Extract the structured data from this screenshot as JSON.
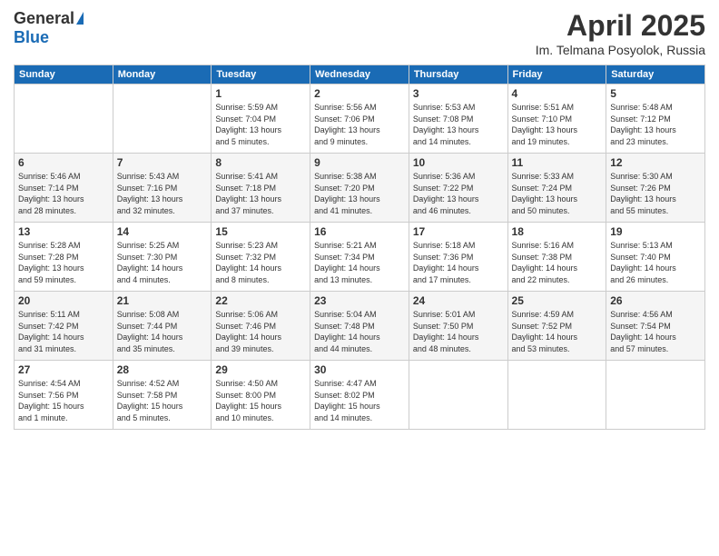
{
  "logo": {
    "general": "General",
    "blue": "Blue"
  },
  "header": {
    "title": "April 2025",
    "subtitle": "Im. Telmana Posyolok, Russia"
  },
  "days_of_week": [
    "Sunday",
    "Monday",
    "Tuesday",
    "Wednesday",
    "Thursday",
    "Friday",
    "Saturday"
  ],
  "weeks": [
    [
      {
        "day": "",
        "info": ""
      },
      {
        "day": "",
        "info": ""
      },
      {
        "day": "1",
        "info": "Sunrise: 5:59 AM\nSunset: 7:04 PM\nDaylight: 13 hours\nand 5 minutes."
      },
      {
        "day": "2",
        "info": "Sunrise: 5:56 AM\nSunset: 7:06 PM\nDaylight: 13 hours\nand 9 minutes."
      },
      {
        "day": "3",
        "info": "Sunrise: 5:53 AM\nSunset: 7:08 PM\nDaylight: 13 hours\nand 14 minutes."
      },
      {
        "day": "4",
        "info": "Sunrise: 5:51 AM\nSunset: 7:10 PM\nDaylight: 13 hours\nand 19 minutes."
      },
      {
        "day": "5",
        "info": "Sunrise: 5:48 AM\nSunset: 7:12 PM\nDaylight: 13 hours\nand 23 minutes."
      }
    ],
    [
      {
        "day": "6",
        "info": "Sunrise: 5:46 AM\nSunset: 7:14 PM\nDaylight: 13 hours\nand 28 minutes."
      },
      {
        "day": "7",
        "info": "Sunrise: 5:43 AM\nSunset: 7:16 PM\nDaylight: 13 hours\nand 32 minutes."
      },
      {
        "day": "8",
        "info": "Sunrise: 5:41 AM\nSunset: 7:18 PM\nDaylight: 13 hours\nand 37 minutes."
      },
      {
        "day": "9",
        "info": "Sunrise: 5:38 AM\nSunset: 7:20 PM\nDaylight: 13 hours\nand 41 minutes."
      },
      {
        "day": "10",
        "info": "Sunrise: 5:36 AM\nSunset: 7:22 PM\nDaylight: 13 hours\nand 46 minutes."
      },
      {
        "day": "11",
        "info": "Sunrise: 5:33 AM\nSunset: 7:24 PM\nDaylight: 13 hours\nand 50 minutes."
      },
      {
        "day": "12",
        "info": "Sunrise: 5:30 AM\nSunset: 7:26 PM\nDaylight: 13 hours\nand 55 minutes."
      }
    ],
    [
      {
        "day": "13",
        "info": "Sunrise: 5:28 AM\nSunset: 7:28 PM\nDaylight: 13 hours\nand 59 minutes."
      },
      {
        "day": "14",
        "info": "Sunrise: 5:25 AM\nSunset: 7:30 PM\nDaylight: 14 hours\nand 4 minutes."
      },
      {
        "day": "15",
        "info": "Sunrise: 5:23 AM\nSunset: 7:32 PM\nDaylight: 14 hours\nand 8 minutes."
      },
      {
        "day": "16",
        "info": "Sunrise: 5:21 AM\nSunset: 7:34 PM\nDaylight: 14 hours\nand 13 minutes."
      },
      {
        "day": "17",
        "info": "Sunrise: 5:18 AM\nSunset: 7:36 PM\nDaylight: 14 hours\nand 17 minutes."
      },
      {
        "day": "18",
        "info": "Sunrise: 5:16 AM\nSunset: 7:38 PM\nDaylight: 14 hours\nand 22 minutes."
      },
      {
        "day": "19",
        "info": "Sunrise: 5:13 AM\nSunset: 7:40 PM\nDaylight: 14 hours\nand 26 minutes."
      }
    ],
    [
      {
        "day": "20",
        "info": "Sunrise: 5:11 AM\nSunset: 7:42 PM\nDaylight: 14 hours\nand 31 minutes."
      },
      {
        "day": "21",
        "info": "Sunrise: 5:08 AM\nSunset: 7:44 PM\nDaylight: 14 hours\nand 35 minutes."
      },
      {
        "day": "22",
        "info": "Sunrise: 5:06 AM\nSunset: 7:46 PM\nDaylight: 14 hours\nand 39 minutes."
      },
      {
        "day": "23",
        "info": "Sunrise: 5:04 AM\nSunset: 7:48 PM\nDaylight: 14 hours\nand 44 minutes."
      },
      {
        "day": "24",
        "info": "Sunrise: 5:01 AM\nSunset: 7:50 PM\nDaylight: 14 hours\nand 48 minutes."
      },
      {
        "day": "25",
        "info": "Sunrise: 4:59 AM\nSunset: 7:52 PM\nDaylight: 14 hours\nand 53 minutes."
      },
      {
        "day": "26",
        "info": "Sunrise: 4:56 AM\nSunset: 7:54 PM\nDaylight: 14 hours\nand 57 minutes."
      }
    ],
    [
      {
        "day": "27",
        "info": "Sunrise: 4:54 AM\nSunset: 7:56 PM\nDaylight: 15 hours\nand 1 minute."
      },
      {
        "day": "28",
        "info": "Sunrise: 4:52 AM\nSunset: 7:58 PM\nDaylight: 15 hours\nand 5 minutes."
      },
      {
        "day": "29",
        "info": "Sunrise: 4:50 AM\nSunset: 8:00 PM\nDaylight: 15 hours\nand 10 minutes."
      },
      {
        "day": "30",
        "info": "Sunrise: 4:47 AM\nSunset: 8:02 PM\nDaylight: 15 hours\nand 14 minutes."
      },
      {
        "day": "",
        "info": ""
      },
      {
        "day": "",
        "info": ""
      },
      {
        "day": "",
        "info": ""
      }
    ]
  ]
}
